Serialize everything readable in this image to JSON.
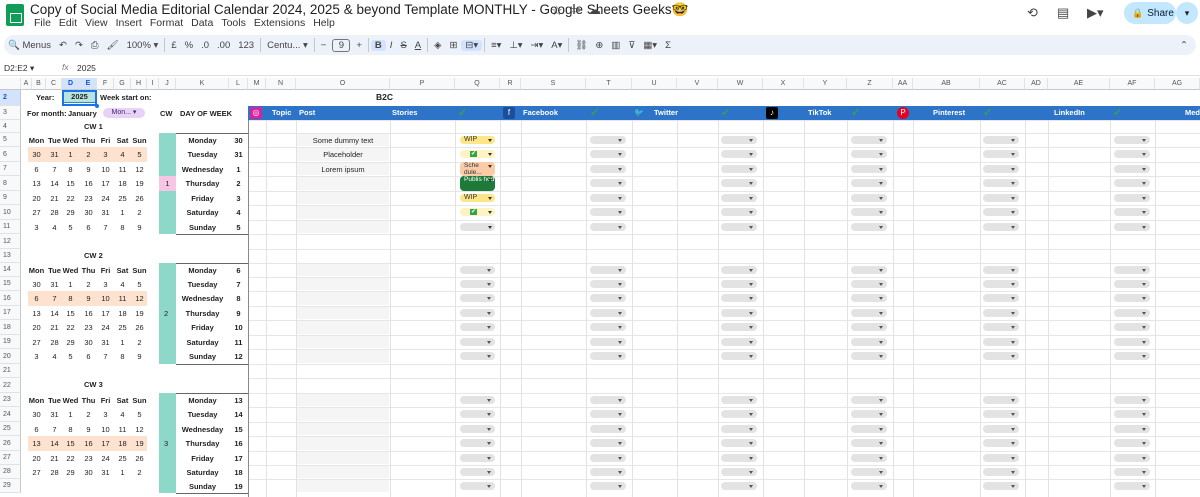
{
  "title_bar": {
    "doc_title": "Copy of Social Media Editorial Calendar 2024, 2025 & beyond Template MONTHLY - Google Sheets Geeks🤓",
    "menu": [
      "File",
      "Edit",
      "View",
      "Insert",
      "Format",
      "Data",
      "Tools",
      "Extensions",
      "Help"
    ],
    "share_label": "Share",
    "icons": [
      "star-icon",
      "folder-icon",
      "cloud-icon",
      "history-icon",
      "comment-icon",
      "video-icon",
      "lock-icon"
    ]
  },
  "toolbar": {
    "menus_label": "Menus",
    "zoom": "100%",
    "currency": "£",
    "percent": "%",
    "dec_dec": ".0",
    "dec_inc": ".00",
    "number_format": "123",
    "font": "Centu...",
    "font_size": "9",
    "minus": "−",
    "plus": "+",
    "bold": "B",
    "sigma": "Σ"
  },
  "formula_bar": {
    "name_box": "D2:E2",
    "fx": "fx",
    "value": "2025"
  },
  "columns": [
    "A",
    "B",
    "C",
    "D",
    "E",
    "F",
    "G",
    "H",
    "I",
    "J",
    "K",
    "L",
    "M",
    "N",
    "O",
    "P",
    "Q",
    "R",
    "S",
    "T",
    "U",
    "V",
    "W",
    "X",
    "Y",
    "Z",
    "AA",
    "AB",
    "AC",
    "AD",
    "AE",
    "AF",
    "AG"
  ],
  "rows": [
    "2",
    "3",
    "4",
    "5",
    "6",
    "7",
    "8",
    "9",
    "10",
    "11",
    "12",
    "13",
    "14",
    "15",
    "16",
    "17",
    "18",
    "19",
    "20",
    "21",
    "22",
    "23",
    "24",
    "25",
    "26",
    "27",
    "28",
    "29"
  ],
  "header": {
    "year_label": "Year:",
    "year": "2025",
    "week_start_label": "Week start on:",
    "month_label": "For month:",
    "month": "January",
    "week_start": "Mon...",
    "cw_col": "CW",
    "dow_col": "DAY OF WEEK",
    "b2c": "B2C",
    "channels": [
      "Topic",
      "Post",
      "Stories",
      "Facebook",
      "Twitter",
      "TikTok",
      "Pinterest",
      "LinkedIn",
      "Med"
    ]
  },
  "weekday_headers": [
    "Mon",
    "Tue",
    "Wed",
    "Thu",
    "Fri",
    "Sat",
    "Sun"
  ],
  "blocks": [
    {
      "cw_label": "CW 1",
      "cw_num": "1",
      "mini_cal": [
        [
          "30",
          "31",
          "1",
          "2",
          "3",
          "4",
          "5"
        ],
        [
          "6",
          "7",
          "8",
          "9",
          "10",
          "11",
          "12"
        ],
        [
          "13",
          "14",
          "15",
          "16",
          "17",
          "18",
          "19"
        ],
        [
          "20",
          "21",
          "22",
          "23",
          "24",
          "25",
          "26"
        ],
        [
          "27",
          "28",
          "29",
          "30",
          "31",
          "1",
          "2"
        ],
        [
          "3",
          "4",
          "5",
          "6",
          "7",
          "8",
          "9"
        ]
      ],
      "days": [
        [
          "Monday",
          "30"
        ],
        [
          "Tuesday",
          "31"
        ],
        [
          "Wednesday",
          "1"
        ],
        [
          "Thursday",
          "2"
        ],
        [
          "Friday",
          "3"
        ],
        [
          "Saturday",
          "4"
        ],
        [
          "Sunday",
          "5"
        ]
      ]
    },
    {
      "cw_label": "CW 2",
      "cw_num": "2",
      "mini_cal": [
        [
          "30",
          "31",
          "1",
          "2",
          "3",
          "4",
          "5"
        ],
        [
          "6",
          "7",
          "8",
          "9",
          "10",
          "11",
          "12"
        ],
        [
          "13",
          "14",
          "15",
          "16",
          "17",
          "18",
          "19"
        ],
        [
          "20",
          "21",
          "22",
          "23",
          "24",
          "25",
          "26"
        ],
        [
          "27",
          "28",
          "29",
          "30",
          "31",
          "1",
          "2"
        ],
        [
          "3",
          "4",
          "5",
          "6",
          "7",
          "8",
          "9"
        ]
      ],
      "days": [
        [
          "Monday",
          "6"
        ],
        [
          "Tuesday",
          "7"
        ],
        [
          "Wednesday",
          "8"
        ],
        [
          "Thursday",
          "9"
        ],
        [
          "Friday",
          "10"
        ],
        [
          "Saturday",
          "11"
        ],
        [
          "Sunday",
          "12"
        ]
      ]
    },
    {
      "cw_label": "CW 3",
      "cw_num": "3",
      "mini_cal": [
        [
          "30",
          "31",
          "1",
          "2",
          "3",
          "4",
          "5"
        ],
        [
          "6",
          "7",
          "8",
          "9",
          "10",
          "11",
          "12"
        ],
        [
          "13",
          "14",
          "15",
          "16",
          "17",
          "18",
          "19"
        ],
        [
          "20",
          "21",
          "22",
          "23",
          "24",
          "25",
          "26"
        ],
        [
          "27",
          "28",
          "29",
          "30",
          "31",
          "1",
          "2"
        ]
      ],
      "days": [
        [
          "Monday",
          "13"
        ],
        [
          "Tuesday",
          "14"
        ],
        [
          "Wednesday",
          "15"
        ],
        [
          "Thursday",
          "16"
        ],
        [
          "Friday",
          "17"
        ],
        [
          "Saturday",
          "18"
        ],
        [
          "Sunday",
          "19"
        ]
      ]
    }
  ],
  "week1_posts": [
    "Some dummy text",
    "Placeholder",
    "Lorem ipsum"
  ],
  "week1_status": [
    {
      "label": "WIP",
      "color": "#fde68a"
    },
    {
      "label": "✔",
      "color": "#fff3c4"
    },
    {
      "label": "Sche dule...",
      "color": "#f9cba7"
    },
    {
      "label": "Publis hed",
      "color": "#1e7a3a"
    },
    {
      "label": "WIP",
      "color": "#fde68a"
    },
    {
      "label": "✔",
      "color": "#fff3c4"
    },
    {
      "label": "",
      "color": "#e3e3e3"
    }
  ],
  "colors": {
    "accent_blue": "#2d74c9",
    "cw_teal": "#8ed8c9",
    "highlight_peach": "#fde2d0",
    "selection": "#d3e3fd"
  }
}
